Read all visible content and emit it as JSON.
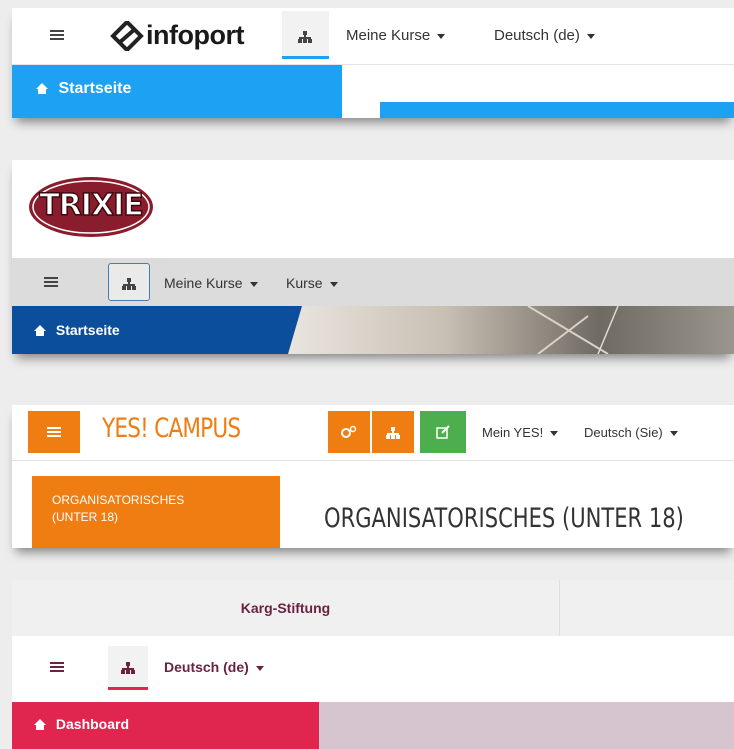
{
  "infoport": {
    "logo_text": "infoport",
    "menu_courses": "Meine Kurse",
    "menu_language": "Deutsch (de)",
    "breadcrumb_home": "Startseite",
    "accent": "#1da1f2"
  },
  "trixie": {
    "logo_text": "TRIXIE",
    "menu_courses": "Meine Kurse",
    "menu_kurse": "Kurse",
    "breadcrumb_home": "Startseite",
    "accent": "#0b4f9c"
  },
  "yescampus": {
    "logo_text": "YES! CAMPUS",
    "menu_mein": "Mein YES!",
    "menu_language": "Deutsch (Sie)",
    "box_label": "ORGANISATORISCHES (UNTER 18)",
    "page_title": "ORGANISATORISCHES (UNTER 18)",
    "accent": "#f07d12",
    "green": "#4cae4c"
  },
  "karg": {
    "tab_label": "Karg-Stiftung",
    "menu_language": "Deutsch (de)",
    "dashboard_label": "Dashboard",
    "accent": "#e0264e"
  }
}
